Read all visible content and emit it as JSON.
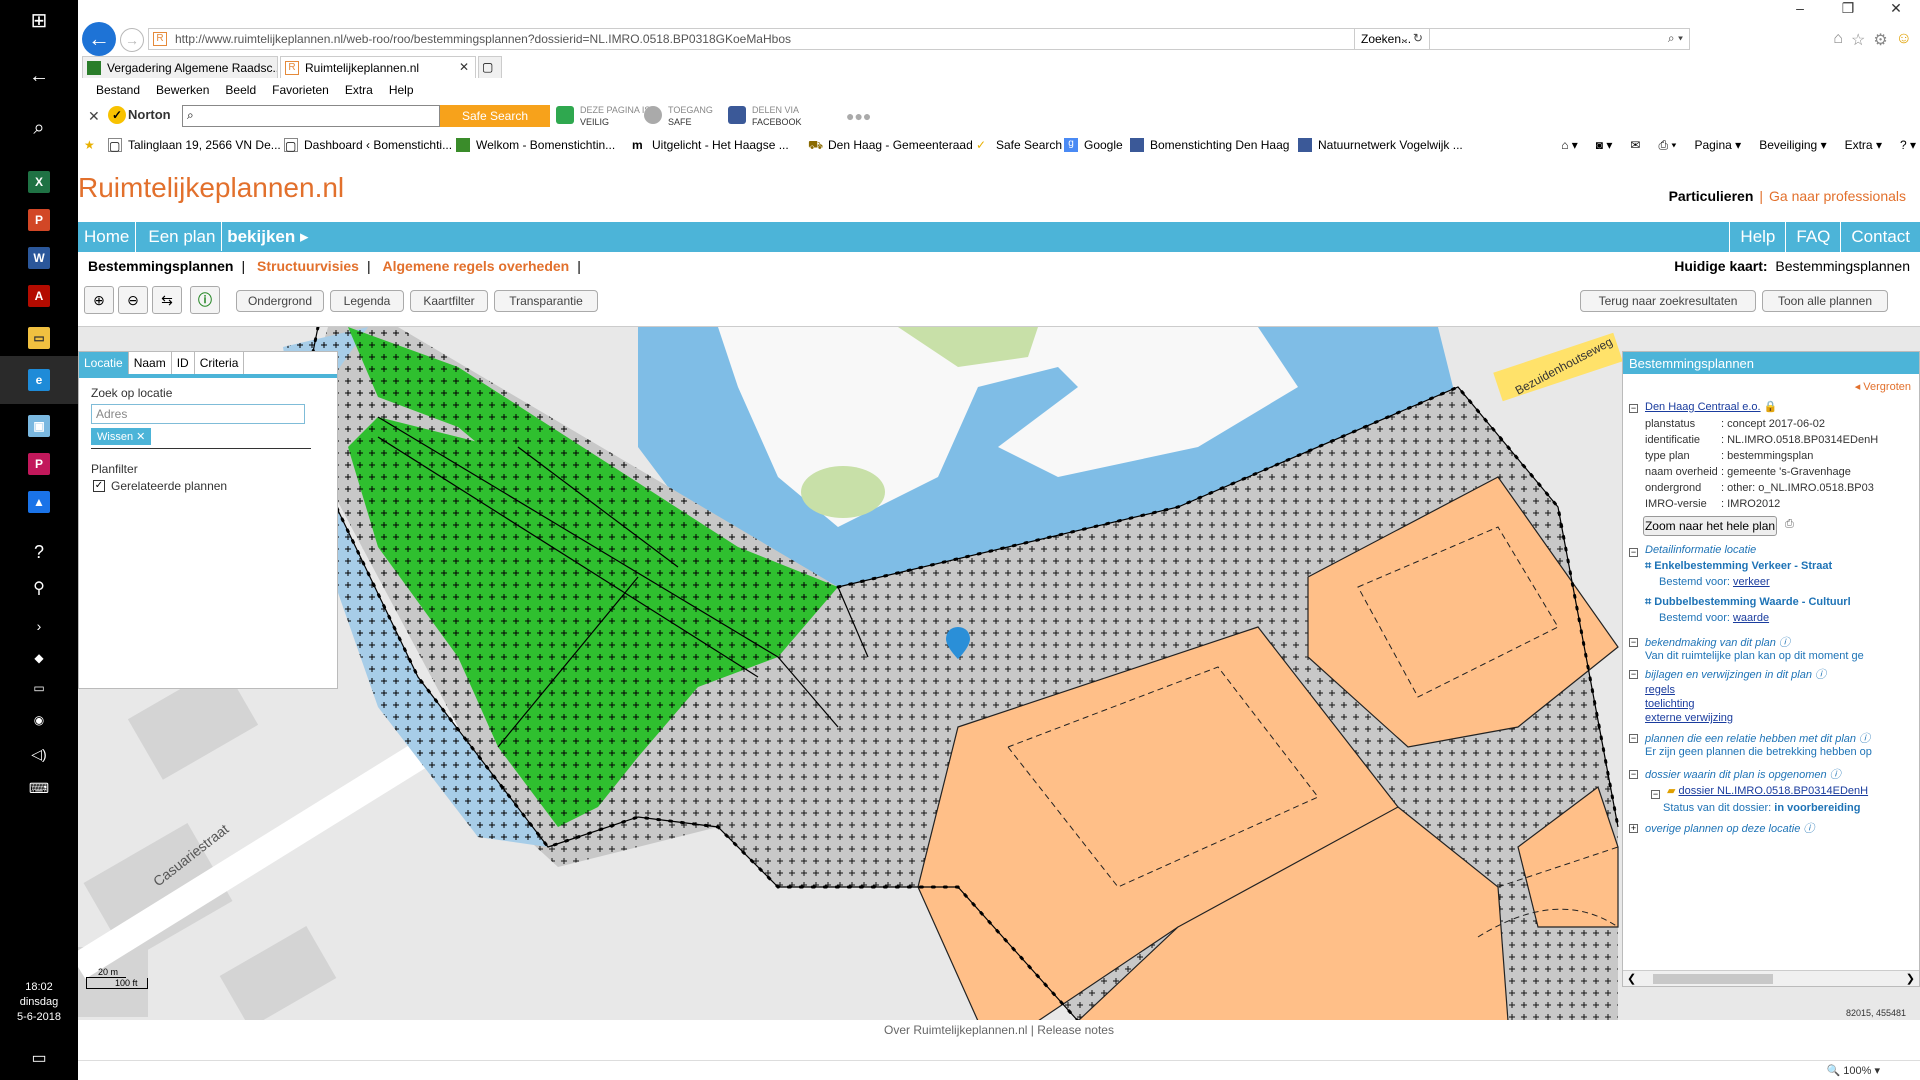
{
  "taskbar": {
    "time": "18:02",
    "day": "dinsdag",
    "date": "5-6-2018"
  },
  "browser": {
    "url": "http://www.ruimtelijkeplannen.nl/web-roo/roo/bestemmingsplannen?dossierid=NL.IMRO.0518.BP0318GKoeMaHbos",
    "search_placeholder": "Zoeken...",
    "tabs": [
      {
        "label": "Vergadering Algemene Raadsc..."
      },
      {
        "label": "Ruimtelijkeplannen.nl"
      }
    ],
    "menu": [
      "Bestand",
      "Bewerken",
      "Beeld",
      "Favorieten",
      "Extra",
      "Help"
    ],
    "norton": {
      "brand": "Norton",
      "safe_search": "Safe Search",
      "page_safe_1": "DEZE PAGINA IS",
      "page_safe_2": "VEILIG",
      "access_1": "TOEGANG",
      "access_2": "SAFE",
      "share_1": "DELEN VIA",
      "share_2": "FACEBOOK"
    },
    "favorites": [
      "Talinglaan 19, 2566 VN De...",
      "Dashboard ‹ Bomenstichti...",
      "Welkom - Bomenstichtin...",
      "Uitgelicht - Het Haagse ...",
      "Den Haag - Gemeenteraad",
      "Safe Search",
      "Google",
      "Bomenstichting Den Haag",
      "Natuurnetwerk Vogelwijk ..."
    ],
    "tools": [
      "Pagina",
      "Beveiliging",
      "Extra"
    ],
    "zoom": "100%"
  },
  "site": {
    "logo": "Ruimtelijkeplannen.nl",
    "audience": "Particulieren",
    "audience_link": "Ga naar professionals",
    "nav_left": [
      "Home",
      "Een plan",
      "bekijken"
    ],
    "nav_right": [
      "Help",
      "FAQ",
      "Contact"
    ],
    "subnav": [
      "Bestemmingsplannen",
      "Structuurvisies",
      "Algemene regels overheden"
    ],
    "current_map_label": "Huidige kaart:",
    "current_map": "Bestemmingsplannen",
    "toolbar": [
      "Ondergrond",
      "Legenda",
      "Kaartfilter",
      "Transparantie"
    ],
    "back_results": "Terug naar zoekresultaten",
    "show_all": "Toon alle plannen",
    "footer_1": "Over Ruimtelijkeplannen.nl",
    "footer_2": "Release notes"
  },
  "left_panel": {
    "tabs": [
      "Locatie",
      "Naam",
      "ID",
      "Criteria"
    ],
    "search_label": "Zoek op locatie",
    "address_placeholder": "Adres",
    "clear": "Wissen",
    "filter_label": "Planfilter",
    "filter_option": "Gerelateerde plannen"
  },
  "right_panel": {
    "title": "Bestemmingsplannen",
    "enlarge": "Vergroten",
    "plan_name": "Den Haag Centraal e.o.",
    "fields": [
      {
        "k": "planstatus",
        "v": ": concept 2017-06-02"
      },
      {
        "k": "identificatie",
        "v": ": NL.IMRO.0518.BP0314EDenH"
      },
      {
        "k": "type plan",
        "v": ": bestemmingsplan"
      },
      {
        "k": "naam overheid",
        "v": ": gemeente 's-Gravenhage"
      },
      {
        "k": "ondergrond",
        "v": ": other: o_NL.IMRO.0518.BP03"
      },
      {
        "k": "IMRO-versie",
        "v": ": IMRO2012"
      }
    ],
    "zoom_button": "Zoom naar het hele plan",
    "detail_header": "Detailinformatie locatie",
    "detail_1_title": "Enkelbestemming Verkeer - Straat",
    "detail_1_sub": "Bestemd voor:",
    "detail_1_link": "verkeer",
    "detail_2_title": "Dubbelbestemming Waarde - Cultuurl",
    "detail_2_sub": "Bestemd voor:",
    "detail_2_link": "waarde",
    "announce_header": "bekendmaking van dit plan",
    "announce_text": "Van dit ruimtelijke plan kan op dit moment ge",
    "attach_header": "bijlagen en verwijzingen in dit plan",
    "attach_links": [
      "regels",
      "toelichting",
      "externe verwijzing"
    ],
    "related_header": "plannen die een relatie hebben met dit plan",
    "related_text": "Er zijn geen plannen die betrekking hebben op",
    "dossier_header": "dossier waarin dit plan is opgenomen",
    "dossier_link": "dossier NL.IMRO.0518.BP0314EDenH",
    "dossier_status_label": "Status van dit dossier:",
    "dossier_status": "in voorbereiding",
    "other_header": "overige plannen op deze locatie"
  },
  "map": {
    "street_1": "Casuariestraat",
    "street_2": "Bezuidenhoutseweg",
    "scale_m": "20 m",
    "scale_ft": "100 ft",
    "coords": "82015, 455481",
    "colors": {
      "green": "#2fbf2f",
      "orange": "#ffbf88",
      "water": "#7fbde6",
      "grey": "#c8c8c8"
    }
  }
}
